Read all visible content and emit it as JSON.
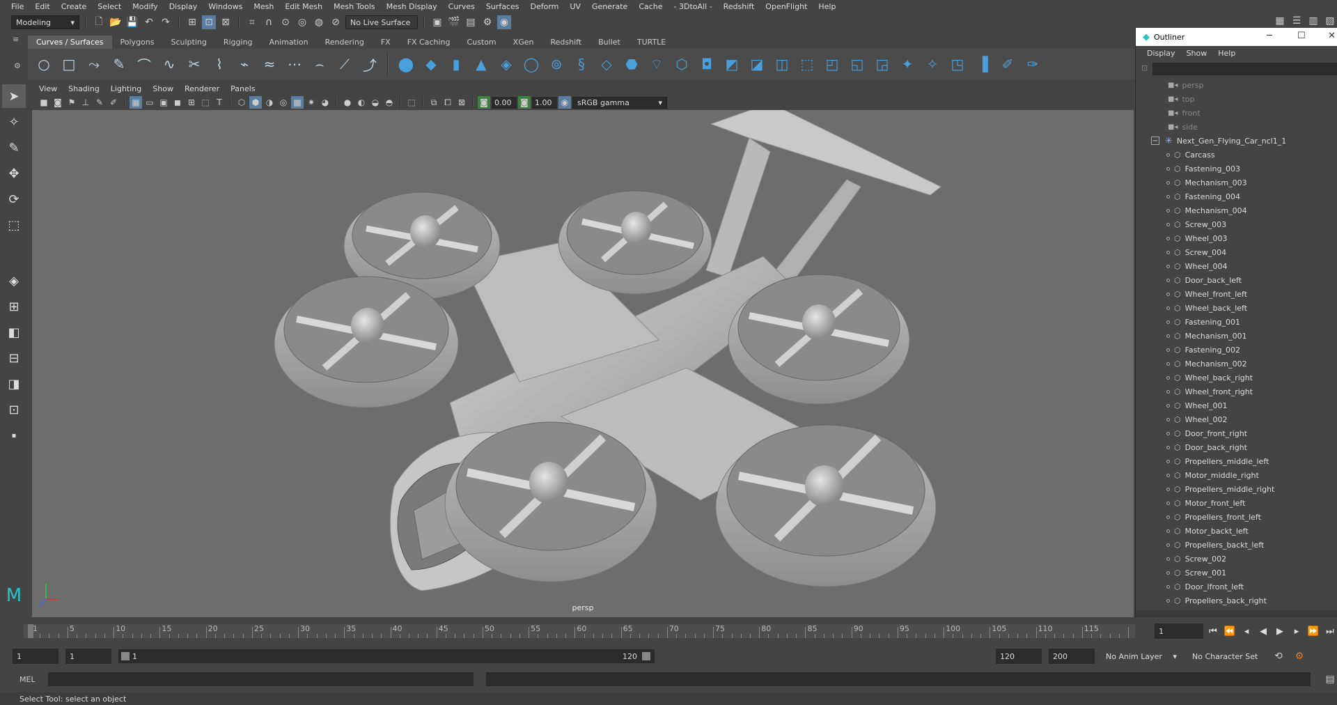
{
  "menubar": [
    "File",
    "Edit",
    "Create",
    "Select",
    "Modify",
    "Display",
    "Windows",
    "Mesh",
    "Edit Mesh",
    "Mesh Tools",
    "Mesh Display",
    "Curves",
    "Surfaces",
    "Deform",
    "UV",
    "Generate",
    "Cache",
    "- 3DtoAll -",
    "Redshift",
    "OpenFlight",
    "Help"
  ],
  "status": {
    "mode": "Modeling",
    "live_surface": "No Live Surface"
  },
  "shelf_tabs": [
    "Curves / Surfaces",
    "Polygons",
    "Sculpting",
    "Rigging",
    "Animation",
    "Rendering",
    "FX",
    "FX Caching",
    "Custom",
    "XGen",
    "Redshift",
    "Bullet",
    "TURTLE"
  ],
  "viewport": {
    "menu": [
      "View",
      "Shading",
      "Lighting",
      "Show",
      "Renderer",
      "Panels"
    ],
    "exposure": "0.00",
    "gamma": "1.00",
    "color_space": "sRGB gamma",
    "camera_label": "persp"
  },
  "outliner": {
    "title": "Outliner",
    "menu": [
      "Display",
      "Show",
      "Help"
    ],
    "cameras": [
      "persp",
      "top",
      "front",
      "side"
    ],
    "group": "Next_Gen_Flying_Car_ncl1_1",
    "children": [
      "Carcass",
      "Fastening_003",
      "Mechanism_003",
      "Fastening_004",
      "Mechanism_004",
      "Screw_003",
      "Wheel_003",
      "Screw_004",
      "Wheel_004",
      "Door_back_left",
      "Wheel_front_left",
      "Wheel_back_left",
      "Fastening_001",
      "Mechanism_001",
      "Fastening_002",
      "Mechanism_002",
      "Wheel_back_right",
      "Wheel_front_right",
      "Wheel_001",
      "Wheel_002",
      "Door_front_right",
      "Door_back_right",
      "Propellers_middle_left",
      "Motor_middle_right",
      "Propellers_middle_right",
      "Motor_front_left",
      "Propellers_front_left",
      "Motor_backt_left",
      "Propellers_backt_left",
      "Screw_002",
      "Screw_001",
      "Door_lfront_left",
      "Propellers_back_right"
    ]
  },
  "timeline": {
    "ticks": [
      "1",
      "5",
      "10",
      "15",
      "20",
      "25",
      "30",
      "35",
      "40",
      "45",
      "50",
      "55",
      "60",
      "65",
      "70",
      "75",
      "80",
      "85",
      "90",
      "95",
      "100",
      "105",
      "110",
      "115"
    ],
    "current_frame": "1"
  },
  "range": {
    "start": "1",
    "playback_start": "1",
    "slider_start": "1",
    "slider_end": "120",
    "playback_end": "120",
    "end": "200",
    "anim_layer": "No Anim Layer",
    "character_set": "No Character Set"
  },
  "command": {
    "lang": "MEL"
  },
  "help_line": "Select Tool: select an object"
}
